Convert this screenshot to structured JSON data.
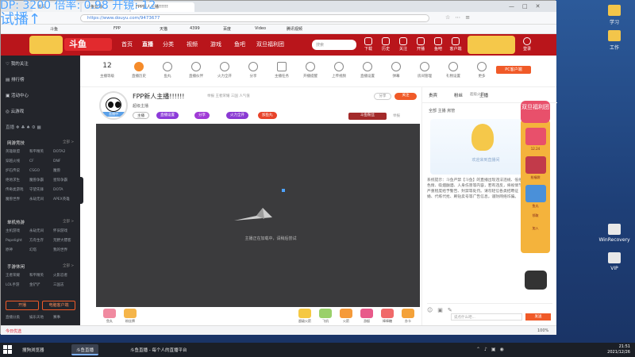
{
  "overlay": {
    "line1": "DP: 3200 倍率: 0.98 开镜: 12",
    "line2": "试播↑"
  },
  "desktop": {
    "icons": [
      {
        "label": "学习",
        "kind": "folder"
      },
      {
        "label": "工作",
        "kind": "folder"
      },
      {
        "label": "WinRecovery",
        "kind": "doc"
      },
      {
        "label": "VIP",
        "kind": "doc"
      }
    ]
  },
  "browser": {
    "tabs": [
      "首页",
      "斗鱼直播",
      "FPP新人主播!!!!!!"
    ],
    "url": "https://www.douyu.com/9473677",
    "bookmarks": [
      "斗鱼",
      "FPP",
      "天猫",
      "4399",
      "百度",
      "Video",
      "腾讯视频"
    ],
    "window_controls": [
      "minimize",
      "maximize",
      "close"
    ]
  },
  "site": {
    "logo": "斗鱼",
    "nav": [
      "首页",
      "直播",
      "分类",
      "视频",
      "游戏",
      "鱼吧",
      "双旦福利团"
    ],
    "search_placeholder": "搜索",
    "top_buttons": [
      "下载",
      "历史",
      "关注",
      "开播",
      "鱼吧",
      "客户端",
      "任务",
      "登录"
    ]
  },
  "leftbar": {
    "items": [
      {
        "icon": "heart-icon",
        "label": "我的关注"
      },
      {
        "icon": "list-icon",
        "label": "排行榜"
      },
      {
        "icon": "gift-icon",
        "label": "活动中心"
      },
      {
        "icon": "game-icon",
        "label": "云游戏"
      }
    ],
    "extra_labels": [
      "直播",
      "游戏",
      "娱乐"
    ],
    "sections": [
      {
        "title": "网游竞技",
        "more": "全部 >",
        "rows": [
          [
            "英雄联盟",
            "和平精英",
            "DOTA2"
          ],
          [
            "穿越火线",
            "CF",
            "DNF"
          ],
          [
            "炉石传说",
            "CSGO",
            "魔兽"
          ],
          [
            "绝地求生",
            "魔兽争霸",
            "星际争霸"
          ],
          [
            "传奇类游戏",
            "守望先锋",
            "DOTA"
          ],
          [
            "魔兽世界",
            "永劫无间",
            "APEX英雄"
          ]
        ]
      },
      {
        "title": "单机热游",
        "more": "全部 >",
        "rows": [
          [
            "主机游戏",
            "永劫无间",
            "怀旧游戏"
          ],
          [
            "Papelight",
            "方舟生存",
            "荒野大镖客"
          ],
          [
            "原神",
            "幻塔",
            "我的世界"
          ]
        ]
      },
      {
        "title": "手游休闲",
        "more": "全部 >",
        "rows": [
          [
            "王者荣耀",
            "和平精英",
            "火影忍者"
          ],
          [
            "LOL手游",
            "金铲铲",
            "三国志"
          ]
        ]
      }
    ],
    "buttons": [
      "开播",
      "电脑客户端"
    ],
    "footer": [
      "直播分类",
      "娱乐天地",
      "赛事",
      "在线人数"
    ]
  },
  "toolbar": {
    "items": [
      {
        "value": "12",
        "label": "主播等级"
      },
      {
        "value": "",
        "label": "直播历史"
      },
      {
        "value": "",
        "label": "鱼丸"
      },
      {
        "value": "",
        "label": "直播伙伴"
      },
      {
        "value": "",
        "label": "火力全开"
      },
      {
        "value": "",
        "label": "分享"
      },
      {
        "value": "",
        "label": "主播任务"
      },
      {
        "value": "",
        "label": "开播提醒"
      },
      {
        "value": "",
        "label": "上传视频"
      },
      {
        "value": "",
        "label": "直播设置"
      },
      {
        "value": "",
        "label": "弹幕"
      },
      {
        "value": "",
        "label": "房间管理"
      },
      {
        "value": "",
        "label": "礼物设置"
      },
      {
        "value": "",
        "label": "更多"
      }
    ],
    "pc_button": "PC客户端"
  },
  "anchor": {
    "avatar_label": "直播中",
    "title": "FPP新人主播!!!!!!",
    "sub_info": [
      "举报",
      "王者荣耀",
      "三国",
      "人气值"
    ],
    "host_name": "超级主播",
    "badges": [
      "主播",
      "直播设置",
      "分享",
      "火力全开",
      "加鱼丸"
    ],
    "right_buttons": [
      "分享",
      "关注"
    ],
    "right_tags": [
      "贵宾",
      "主播"
    ],
    "stats": [
      "斗鱼粉丝",
      "举报"
    ]
  },
  "video": {
    "loading_text": "主播正在加载中，请稍后尝试"
  },
  "gifts": [
    "鱼丸",
    "粉丝牌",
    "超级火箭",
    "飞机",
    "火箭",
    "游艇",
    "棒棒糖",
    "办卡",
    "送礼物"
  ],
  "chat": {
    "tabs": [
      "贵宾",
      "粉丝",
      "主播"
    ],
    "filters": [
      "全部",
      "主播",
      "房管"
    ],
    "header_note": "超级火箭",
    "banner_text": "欢迎来到直播间",
    "system_msg": "系统提示：斗鱼严禁【斗鱼】的直播出现违法违规、低俗色情、吸烟酗酒、人身伤害等内容，若有违反，将视情节严重程度给予警告、封禁等处罚。请勿轻信各类招聘征婚、代练代抢、刷钻卖号等广告信息，谨防网络诈骗。",
    "input_placeholder": "说点什么吧...",
    "send_label": "发送"
  },
  "promo": {
    "title": "双旦福利团",
    "items": [
      "12.24",
      "抢福袋",
      "鱼丸",
      "领取",
      "加入"
    ]
  },
  "statusbar": {
    "left": "今日优选",
    "right_items": [
      "100%",
      "浏览器"
    ]
  },
  "taskbar": {
    "tasks": [
      "搜狗浏览器",
      "斗鱼直播",
      "斗鱼直播 - 每个人的直播平台"
    ],
    "time": "21:51",
    "date": "2021/12/26"
  }
}
